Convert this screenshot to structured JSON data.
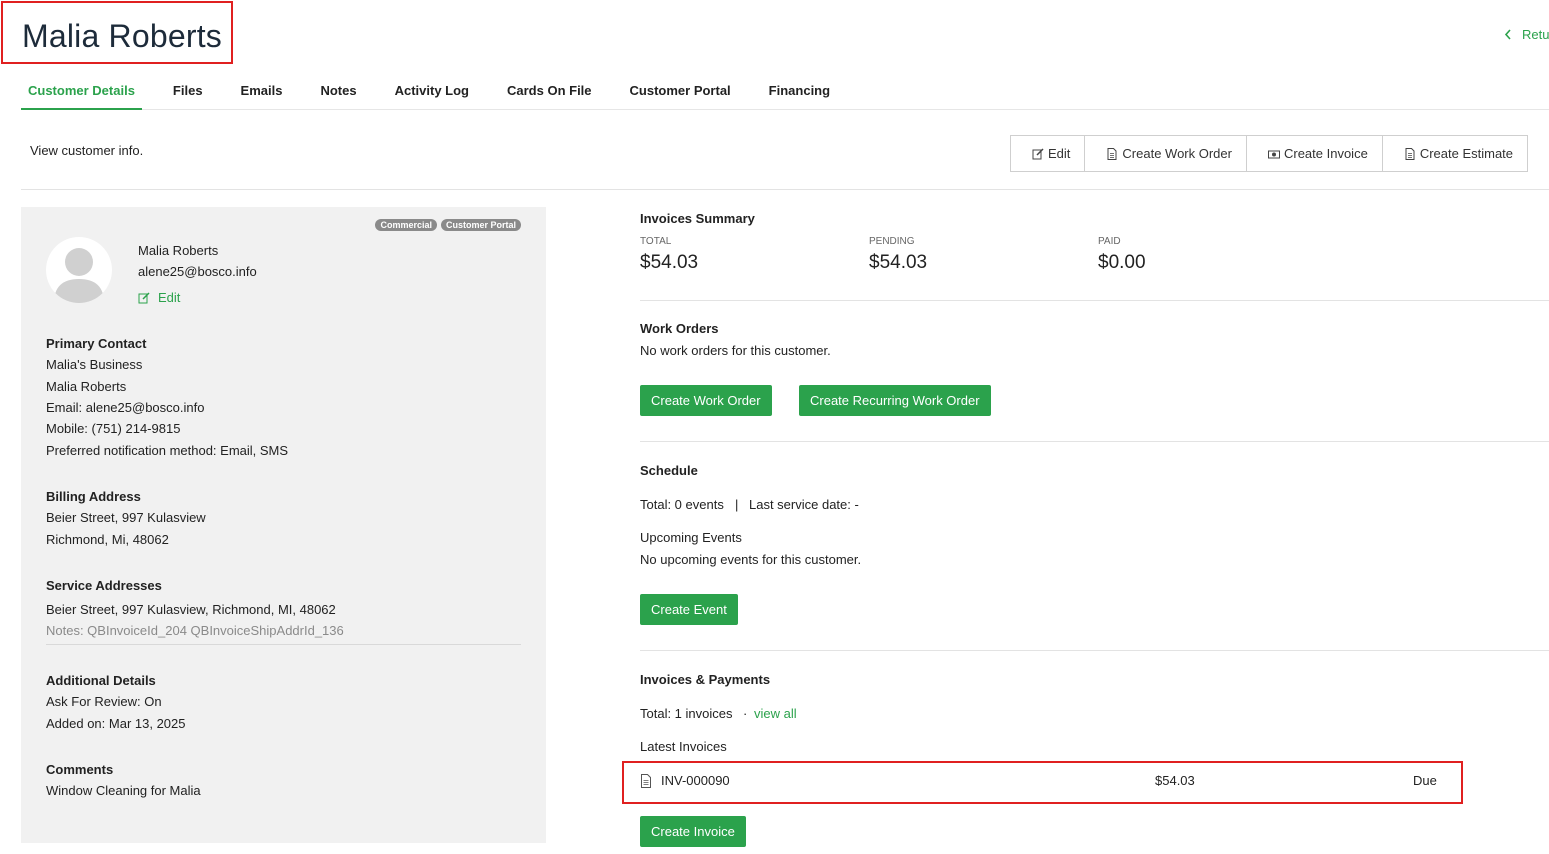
{
  "header": {
    "title": "Malia Roberts",
    "return_label": "Retu"
  },
  "tabs": [
    {
      "label": "Customer Details"
    },
    {
      "label": "Files"
    },
    {
      "label": "Emails"
    },
    {
      "label": "Notes"
    },
    {
      "label": "Activity Log"
    },
    {
      "label": "Cards On File"
    },
    {
      "label": "Customer Portal"
    },
    {
      "label": "Financing"
    }
  ],
  "subtitle": "View customer info.",
  "actions": {
    "edit": "Edit",
    "create_work_order": "Create Work Order",
    "create_invoice": "Create Invoice",
    "create_estimate": "Create Estimate"
  },
  "profile": {
    "badges": [
      "Commercial",
      "Customer Portal"
    ],
    "name": "Malia Roberts",
    "email": "alene25@bosco.info",
    "edit_label": "Edit",
    "primary_contact": {
      "heading": "Primary Contact",
      "business": "Malia's Business",
      "name": "Malia Roberts",
      "email": "Email: alene25@bosco.info",
      "mobile": "Mobile: (751) 214-9815",
      "notification": "Preferred notification method: Email, SMS"
    },
    "billing": {
      "heading": "Billing Address",
      "line1": "Beier Street, 997 Kulasview",
      "line2": "Richmond, Mi, 48062"
    },
    "service": {
      "heading": "Service Addresses",
      "line1": "Beier Street, 997 Kulasview, Richmond, MI, 48062",
      "notes": "Notes: QBInvoiceId_204 QBInvoiceShipAddrId_136"
    },
    "additional": {
      "heading": "Additional Details",
      "review": "Ask For Review: On",
      "added": "Added on: Mar 13, 2025"
    },
    "comments": {
      "heading": "Comments",
      "text": "Window Cleaning for Malia"
    }
  },
  "invoices_summary": {
    "heading": "Invoices Summary",
    "total_label": "TOTAL",
    "total": "$54.03",
    "pending_label": "PENDING",
    "pending": "$54.03",
    "paid_label": "PAID",
    "paid": "$0.00"
  },
  "work_orders": {
    "heading": "Work Orders",
    "empty": "No work orders for this customer.",
    "create": "Create Work Order",
    "create_recurring": "Create Recurring Work Order"
  },
  "schedule": {
    "heading": "Schedule",
    "total": "Total: 0 events",
    "separator": "|",
    "last_service": "Last service date: -",
    "upcoming_heading": "Upcoming Events",
    "upcoming_empty": "No upcoming events for this customer.",
    "create": "Create Event"
  },
  "invoices_payments": {
    "heading": "Invoices & Payments",
    "total": "Total: 1 invoices",
    "dot": "·",
    "view_all": "view all",
    "latest_heading": "Latest Invoices",
    "items": [
      {
        "number": "INV-000090",
        "amount": "$54.03",
        "status": "Due"
      }
    ],
    "create": "Create Invoice"
  },
  "colors": {
    "accent": "#2ba24c",
    "highlight": "#e02020",
    "panel": "#f1f1f1"
  },
  "icons": [
    "chevron-left-icon",
    "edit-icon",
    "document-icon",
    "money-icon",
    "avatar-icon"
  ]
}
